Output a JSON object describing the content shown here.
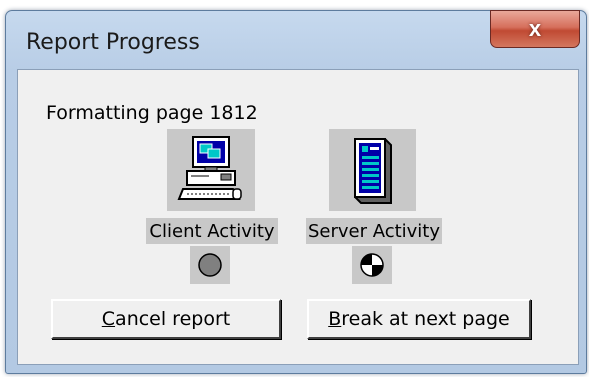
{
  "window": {
    "title": "Report Progress",
    "close_glyph": "x"
  },
  "status": {
    "text": "Formatting page 1812"
  },
  "client_activity": {
    "label": "Client Activity",
    "icon": "computer-icon",
    "indicator": "idle-circle"
  },
  "server_activity": {
    "label": "Server Activity",
    "icon": "server-icon",
    "indicator": "busy-quarters-circle"
  },
  "buttons": {
    "cancel": {
      "mnemonic": "C",
      "rest": "ancel report"
    },
    "break": {
      "mnemonic": "B",
      "rest": "reak at next page"
    }
  },
  "colors": {
    "title_bar": "#c6d9ee",
    "client_area": "#f0f0f0",
    "icon_background": "#c8c8c8",
    "close_button": "#c9503a"
  }
}
